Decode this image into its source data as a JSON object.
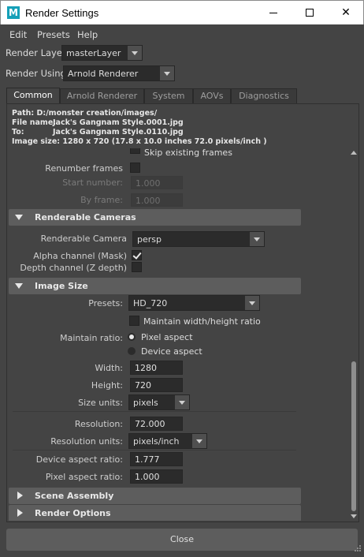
{
  "window": {
    "app_icon": "maya-icon",
    "title": "Render Settings",
    "minimize": "—",
    "maximize": "☐",
    "close": "✕"
  },
  "menu": {
    "edit": "Edit",
    "presets": "Presets",
    "help": "Help"
  },
  "render_layer": {
    "label": "Render Layer",
    "value": "masterLayer"
  },
  "render_using": {
    "label": "Render Using",
    "value": "Arnold Renderer"
  },
  "tabs": [
    "Common",
    "Arnold Renderer",
    "System",
    "AOVs",
    "Diagnostics"
  ],
  "info": {
    "path": "Path: D:/monster creation/images/",
    "file_name_label": "File name:",
    "file_name": "Jack's Gangnam Style.0001.jpg",
    "to_label": "To:",
    "to": "Jack's Gangnam Style.0110.jpg",
    "image_size": "Image size: 1280 x 720 (17.8 x 10.0 inches 72.0 pixels/inch )"
  },
  "frame_range": {
    "skip_existing": "Skip existing frames",
    "renumber_frames": "Renumber frames",
    "start_number_label": "Start number:",
    "start_number": "1.000",
    "by_frame_label": "By frame:",
    "by_frame": "1.000"
  },
  "renderable_cameras": {
    "header": "Renderable Cameras",
    "camera_label": "Renderable Camera",
    "camera_value": "persp",
    "alpha_label": "Alpha channel (Mask)",
    "alpha_checked": true,
    "depth_label": "Depth channel (Z depth)",
    "depth_checked": false
  },
  "image_size": {
    "header": "Image Size",
    "presets_label": "Presets:",
    "presets_value": "HD_720",
    "maintain_ratio_checkbox": "Maintain width/height ratio",
    "maintain_ratio_label": "Maintain ratio:",
    "pixel_aspect_option": "Pixel aspect",
    "device_aspect_option": "Device aspect",
    "width_label": "Width:",
    "width": "1280",
    "height_label": "Height:",
    "height": "720",
    "size_units_label": "Size units:",
    "size_units": "pixels",
    "resolution_label": "Resolution:",
    "resolution": "72.000",
    "resolution_units_label": "Resolution units:",
    "resolution_units": "pixels/inch",
    "device_aspect_label": "Device aspect ratio:",
    "device_aspect": "1.777",
    "pixel_aspect_label": "Pixel aspect ratio:",
    "pixel_aspect": "1.000"
  },
  "collapsed_sections": [
    "Scene Assembly",
    "Render Options"
  ],
  "close_button": "Close"
}
